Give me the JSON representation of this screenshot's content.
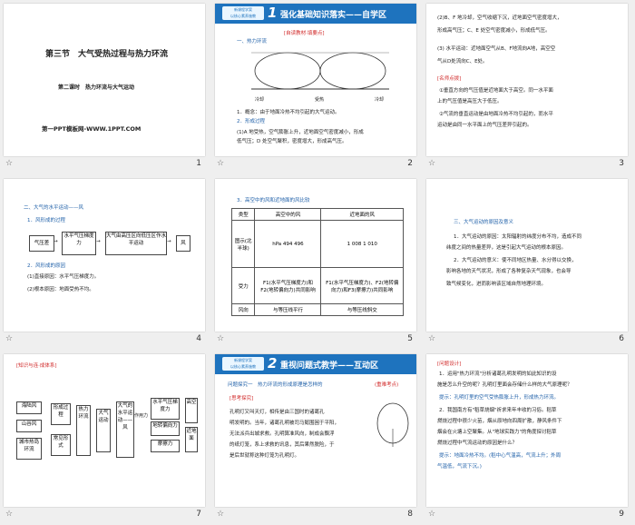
{
  "slides": [
    {
      "num": "1",
      "title": "第三节　大气受热过程与热力环流",
      "subtitle": "第二课时　热力环流与大气运动",
      "site": "第一PPT模板网-WWW.1PPT.COM"
    },
    {
      "num": "2",
      "banner": "强化基础知识落实——自学区",
      "tag": "[自读教材·填要点]",
      "h": "一、热力环流",
      "diagram_labels": [
        "冷却",
        "受热",
        "冷却"
      ],
      "lines": [
        "1．概念：由于地面冷热不均引起的大气运动。",
        "2．形成过程",
        "(1)A 地受热，空气膨胀上升，近地面空气密度减小，形成",
        "低气压；D 处空气聚积，密度增大，形成高气压。"
      ],
      "blanks": [
        "冷热不均",
        "膨胀上升",
        "低气压",
        "高气压"
      ]
    },
    {
      "num": "3",
      "lines": [
        "(2)B、F 地冷却，空气收缩下沉，近地面空气密度增大，",
        "形成高气压；C、E 处空气密度减小，形成低气压。",
        "(3) 水平运动：近地面空气从B、F地流向A地，高空空",
        "气从D处流向C、E处。"
      ],
      "tag": "[名师点拨]",
      "notes": [
        "①垂直方向的气压值是近地面大于高空。同一水平面",
        "上的气压值是高压大于低压。",
        "②气流的垂直运动是由地面冷热不均引起的，而水平",
        "运动是由同一水平面上的气压差异引起的。"
      ],
      "blanks": [
        "收缩下沉",
        "高气压",
        "低气压",
        "B、F",
        "A",
        "D",
        "C、E"
      ]
    },
    {
      "num": "4",
      "h": "二、大气的水平运动——风",
      "h1": "1．风形成的过程",
      "flow": [
        "气压差",
        "水平气压梯度力",
        "大气由高压区向低压区作水平运动",
        "风"
      ],
      "h2": "2．风形成的原因",
      "c1": "(1)直接原因：水平气压梯度力。",
      "c2": "(2)根本原因：地面受热不均。"
    },
    {
      "num": "5",
      "h": "3．高空中的风和近地面的风比较",
      "head": [
        "类型",
        "高空中的风",
        "近地面的风"
      ],
      "rows": [
        {
          "k": "图示(北半球)",
          "a": "hPa 494 496",
          "b": "1 008 1 010"
        },
        {
          "k": "受力",
          "a": "F1(水平气压梯度力)和F2(地转偏向力)共同影响",
          "b": "F1(水平气压梯度力)、F2(地转偏向力)和F3(摩擦力)共同影响"
        },
        {
          "k": "风向",
          "a": "与等压线平行",
          "b": "与等压线斜交"
        }
      ]
    },
    {
      "num": "6",
      "h": "三、大气运动的原因及意义",
      "lines": [
        "1．大气运动的原因：太阳辐射的纬度分布不均，造成不同",
        "纬度之间的热量差异，这是引起大气运动的根本原因。",
        "2．大气运动的意义：使不同地区热量、水分得以交换，",
        "影响各地的天气状况，形成了各种复杂天气现象，也会导",
        "致气候变化，进而影响该区域自然地理环境。"
      ]
    },
    {
      "num": "7",
      "tag": "[知识与连·成体系]",
      "left": [
        "海陆风",
        "山谷风",
        "城市热岛环流"
      ],
      "mid1": [
        "形成过程",
        "常见形式"
      ],
      "mid2": "热力环流",
      "mid3": "大气运动",
      "mid4": "大气的水平运动——风",
      "right": [
        "水平气压梯度力",
        "地转偏向力",
        "摩擦力"
      ],
      "far": [
        "高空",
        "近地面"
      ],
      "arrow": "作用力"
    },
    {
      "num": "8",
      "banner": "重视问题式教学——互动区",
      "h": "问题探究一　热力环流的形成原理是怎样的",
      "badge": "(重难考点)",
      "tag": "[思考探究]",
      "lines": [
        "孔明灯又叫天灯，相传是由三国时的诸葛孔",
        "明发明的。当年，诸葛孔明被司马懿围困于平阳，",
        "无法派兵出城求救。孔明算准风向，制成会飘浮",
        "的纸灯笼，系上求救的讯息，其后果然脱险，于",
        "是后世就称这种灯笼为孔明灯。"
      ]
    },
    {
      "num": "9",
      "tag": "[问题设计]",
      "lines": [
        "1．运用\"热力环流\"分析诸葛孔明发明的如此知识的设",
        "施是怎么升空的呢？孔明灯里面会存储什么样的大气原理呢？",
        "提示：孔明灯里的空气受热膨胀上升，形成热力环流。",
        "2．我国南方有\"稻草烧烟\"祈求来年丰收的习俗。稻草",
        "燃烧过程中很少火苗，烟从原地向四周扩散，静风条件下",
        "烟会在火塘上空聚集。从\"地球实践力\"的角度探讨稻草",
        "燃烧过程中气流运动的原因是什么？",
        "提示：地面冷热不均。(稻中心气温高，气流上升；外周",
        "气温低，气流下沉。)"
      ]
    }
  ]
}
